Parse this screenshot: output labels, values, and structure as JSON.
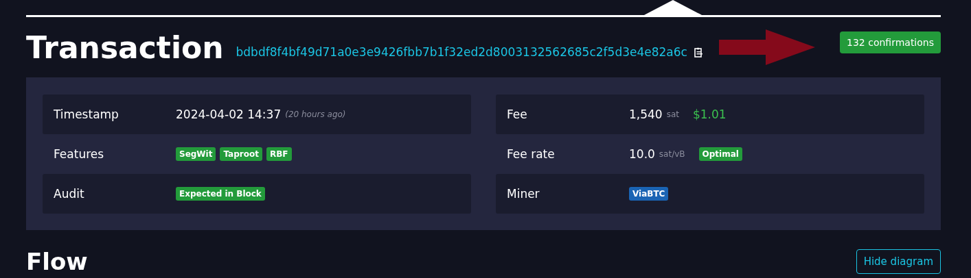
{
  "header": {
    "title": "Transaction",
    "txid": "bdbdf8f4bf49d71a0e3e9426fbb7b1f32ed2d8003132562685c2f5d3e4e82a6c",
    "confirmations": "132 confirmations"
  },
  "details": [
    [
      {
        "label": "Timestamp",
        "parts": [
          {
            "kind": "text",
            "text": "2024-04-02 14:37"
          },
          {
            "kind": "note",
            "text": "(20 hours ago)"
          }
        ]
      },
      {
        "label": "Features",
        "parts": [
          {
            "kind": "tag",
            "text": "SegWit",
            "color": "#239b3b"
          },
          {
            "kind": "tag",
            "text": "Taproot",
            "color": "#239b3b"
          },
          {
            "kind": "tag",
            "text": "RBF",
            "color": "#239b3b"
          }
        ]
      },
      {
        "label": "Audit",
        "parts": [
          {
            "kind": "tag",
            "text": "Expected in Block",
            "color": "#239b3b"
          }
        ]
      }
    ],
    [
      {
        "label": "Fee",
        "parts": [
          {
            "kind": "text",
            "text": "1,540"
          },
          {
            "kind": "unit",
            "text": "sat"
          },
          {
            "kind": "fiat",
            "text": "$1.01"
          }
        ]
      },
      {
        "label": "Fee rate",
        "parts": [
          {
            "kind": "text",
            "text": "10.0"
          },
          {
            "kind": "unit",
            "text": "sat/vB"
          },
          {
            "kind": "tag",
            "text": "Optimal",
            "color": "#239b3b"
          }
        ]
      },
      {
        "label": "Miner",
        "parts": [
          {
            "kind": "tag",
            "text": "ViaBTC",
            "color": "#1a64b4"
          }
        ]
      }
    ]
  ],
  "flow": {
    "title": "Flow",
    "button": "Hide diagram"
  }
}
